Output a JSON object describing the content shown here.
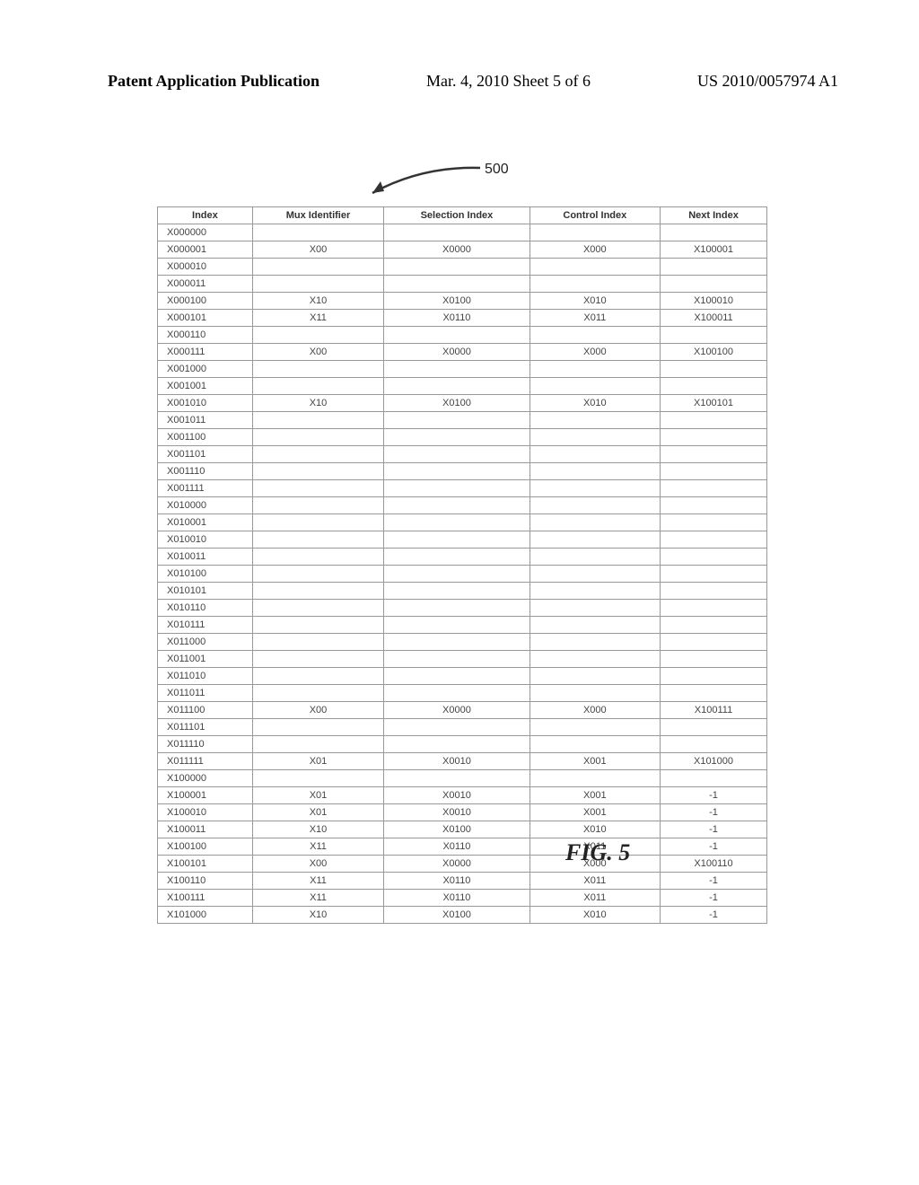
{
  "header": {
    "left": "Patent Application Publication",
    "mid": "Mar. 4, 2010  Sheet 5 of 6",
    "right": "US 2010/0057974 A1"
  },
  "figure_ref": "500",
  "figure_caption": "FIG. 5",
  "table": {
    "headers": [
      "Index",
      "Mux Identifier",
      "Selection Index",
      "Control Index",
      "Next Index"
    ],
    "rows": [
      [
        "X000000",
        "",
        "",
        "",
        ""
      ],
      [
        "X000001",
        "X00",
        "X0000",
        "X000",
        "X100001"
      ],
      [
        "X000010",
        "",
        "",
        "",
        ""
      ],
      [
        "X000011",
        "",
        "",
        "",
        ""
      ],
      [
        "X000100",
        "X10",
        "X0100",
        "X010",
        "X100010"
      ],
      [
        "X000101",
        "X11",
        "X0110",
        "X011",
        "X100011"
      ],
      [
        "X000110",
        "",
        "",
        "",
        ""
      ],
      [
        "X000111",
        "X00",
        "X0000",
        "X000",
        "X100100"
      ],
      [
        "X001000",
        "",
        "",
        "",
        ""
      ],
      [
        "X001001",
        "",
        "",
        "",
        ""
      ],
      [
        "X001010",
        "X10",
        "X0100",
        "X010",
        "X100101"
      ],
      [
        "X001011",
        "",
        "",
        "",
        ""
      ],
      [
        "X001100",
        "",
        "",
        "",
        ""
      ],
      [
        "X001101",
        "",
        "",
        "",
        ""
      ],
      [
        "X001110",
        "",
        "",
        "",
        ""
      ],
      [
        "X001111",
        "",
        "",
        "",
        ""
      ],
      [
        "X010000",
        "",
        "",
        "",
        ""
      ],
      [
        "X010001",
        "",
        "",
        "",
        ""
      ],
      [
        "X010010",
        "",
        "",
        "",
        ""
      ],
      [
        "X010011",
        "",
        "",
        "",
        ""
      ],
      [
        "X010100",
        "",
        "",
        "",
        ""
      ],
      [
        "X010101",
        "",
        "",
        "",
        ""
      ],
      [
        "X010110",
        "",
        "",
        "",
        ""
      ],
      [
        "X010111",
        "",
        "",
        "",
        ""
      ],
      [
        "X011000",
        "",
        "",
        "",
        ""
      ],
      [
        "X011001",
        "",
        "",
        "",
        ""
      ],
      [
        "X011010",
        "",
        "",
        "",
        ""
      ],
      [
        "X011011",
        "",
        "",
        "",
        ""
      ],
      [
        "X011100",
        "X00",
        "X0000",
        "X000",
        "X100111"
      ],
      [
        "X011101",
        "",
        "",
        "",
        ""
      ],
      [
        "X011110",
        "",
        "",
        "",
        ""
      ],
      [
        "X011111",
        "X01",
        "X0010",
        "X001",
        "X101000"
      ],
      [
        "X100000",
        "",
        "",
        "",
        ""
      ],
      [
        "X100001",
        "X01",
        "X0010",
        "X001",
        "-1"
      ],
      [
        "X100010",
        "X01",
        "X0010",
        "X001",
        "-1"
      ],
      [
        "X100011",
        "X10",
        "X0100",
        "X010",
        "-1"
      ],
      [
        "X100100",
        "X11",
        "X0110",
        "X011",
        "-1"
      ],
      [
        "X100101",
        "X00",
        "X0000",
        "X000",
        "X100110"
      ],
      [
        "X100110",
        "X11",
        "X0110",
        "X011",
        "-1"
      ],
      [
        "X100111",
        "X11",
        "X0110",
        "X011",
        "-1"
      ],
      [
        "X101000",
        "X10",
        "X0100",
        "X010",
        "-1"
      ]
    ]
  }
}
